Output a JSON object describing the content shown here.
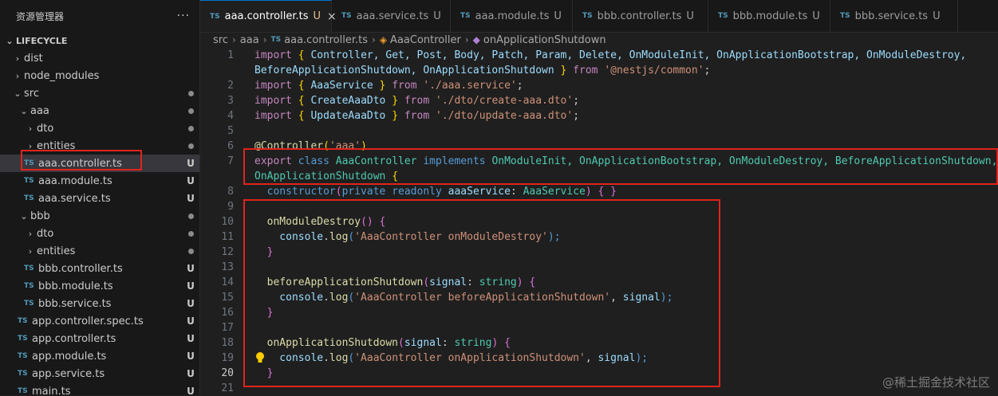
{
  "explorer": {
    "title": "资源管理器",
    "more": "···",
    "section": "LIFECYCLE",
    "items": [
      {
        "label": "dist",
        "status": ""
      },
      {
        "label": "node_modules",
        "status": ""
      },
      {
        "label": "src",
        "status": ""
      },
      {
        "label": "aaa",
        "status": ""
      },
      {
        "label": "dto",
        "status": ""
      },
      {
        "label": "entities",
        "status": ""
      },
      {
        "label": "aaa.controller.ts",
        "status": "U"
      },
      {
        "label": "aaa.module.ts",
        "status": "U"
      },
      {
        "label": "aaa.service.ts",
        "status": "U"
      },
      {
        "label": "bbb",
        "status": ""
      },
      {
        "label": "dto",
        "status": ""
      },
      {
        "label": "entities",
        "status": ""
      },
      {
        "label": "bbb.controller.ts",
        "status": "U"
      },
      {
        "label": "bbb.module.ts",
        "status": "U"
      },
      {
        "label": "bbb.service.ts",
        "status": "U"
      },
      {
        "label": "app.controller.spec.ts",
        "status": "U"
      },
      {
        "label": "app.controller.ts",
        "status": "U"
      },
      {
        "label": "app.module.ts",
        "status": "U"
      },
      {
        "label": "app.service.ts",
        "status": "U"
      },
      {
        "label": "main.ts",
        "status": "U"
      }
    ]
  },
  "tabs": [
    {
      "label": "aaa.controller.ts",
      "status": "U",
      "close": "×"
    },
    {
      "label": "aaa.service.ts",
      "status": "U"
    },
    {
      "label": "aaa.module.ts",
      "status": "U"
    },
    {
      "label": "bbb.controller.ts",
      "status": "U"
    },
    {
      "label": "bbb.module.ts",
      "status": "U"
    },
    {
      "label": "bbb.service.ts",
      "status": "U"
    }
  ],
  "breadcrumb": {
    "src": "src",
    "aaa": "aaa",
    "file": "aaa.controller.ts",
    "class": "AaaController",
    "method": "onApplicationShutdown"
  },
  "ts_icon": "TS",
  "line_numbers": [
    "1",
    "",
    "2",
    "3",
    "4",
    "5",
    "6",
    "7",
    "",
    "8",
    "9",
    "10",
    "11",
    "12",
    "13",
    "14",
    "15",
    "16",
    "17",
    "18",
    "19",
    "20",
    "21"
  ],
  "code": {
    "l1a_import": "import",
    "l1a_b1": "{",
    "l1a_names": " Controller, Get, Post, Body, Patch, Param, Delete, OnModuleInit, OnApplicationBootstrap, OnModuleDestroy,",
    "l1b_names": "BeforeApplicationShutdown, OnApplicationShutdown ",
    "l1b_b2": "}",
    "l1b_from": " from ",
    "l1b_str": "'@nestjs/common'",
    "l1b_semi": ";",
    "l2_import": "import",
    "l2_ob": " { ",
    "l2_name": "AaaService",
    "l2_cb": " }",
    "l2_from": " from ",
    "l2_str": "'./aaa.service'",
    "l2_semi": ";",
    "l3_import": "import",
    "l3_ob": " { ",
    "l3_name": "CreateAaaDto",
    "l3_cb": " }",
    "l3_from": " from ",
    "l3_str": "'./dto/create-aaa.dto'",
    "l3_semi": ";",
    "l4_import": "import",
    "l4_ob": " { ",
    "l4_name": "UpdateAaaDto",
    "l4_cb": " }",
    "l4_from": " from ",
    "l4_str": "'./dto/update-aaa.dto'",
    "l4_semi": ";",
    "l6_at": "@",
    "l6_dec": "Controller",
    "l6_op": "(",
    "l6_str": "'aaa'",
    "l6_cp": ")",
    "l7_export": "export",
    "l7_class": " class ",
    "l7_name": "AaaController",
    "l7_impl": " implements ",
    "l7_ifaces": "OnModuleInit, OnApplicationBootstrap, OnModuleDestroy, BeforeApplicationShutdown,",
    "l7b_iface": "OnApplicationShutdown",
    "l7b_brace": " {",
    "l8_ctor": "  constructor",
    "l8_op": "(",
    "l8_private": "private",
    "l8_readonly": " readonly ",
    "l8_param": "aaaService",
    "l8_colon": ": ",
    "l8_type": "AaaService",
    "l8_cp": ")",
    "l8_body": " { }",
    "l10_fn": "  onModuleDestroy",
    "l10_rest": "() {",
    "l11_console": "    console",
    "l11_dot": ".",
    "l11_log": "log",
    "l11_op": "(",
    "l11_str": "'AaaController onModuleDestroy'",
    "l11_cp": ");",
    "l12": "  }",
    "l14_fn": "  beforeApplicationShutdown",
    "l14_op": "(",
    "l14_param": "signal",
    "l14_colon": ": ",
    "l14_type": "string",
    "l14_rest": ") {",
    "l15_console": "    console",
    "l15_dot": ".",
    "l15_log": "log",
    "l15_op": "(",
    "l15_str": "'AaaController beforeApplicationShutdown'",
    "l15_comma": ", ",
    "l15_arg": "signal",
    "l15_cp": ");",
    "l16": "  }",
    "l18_fn": "  onApplicationShutdown",
    "l18_op": "(",
    "l18_param": "signal",
    "l18_colon": ": ",
    "l18_type": "string",
    "l18_rest": ") {",
    "l19_console": "    console",
    "l19_dot": ".",
    "l19_log": "log",
    "l19_op": "(",
    "l19_str": "'AaaController onApplicationShutdown'",
    "l19_comma": ", ",
    "l19_arg": "signal",
    "l19_cp": ");",
    "l20": "  }"
  },
  "watermark": "@稀土掘金技术社区"
}
